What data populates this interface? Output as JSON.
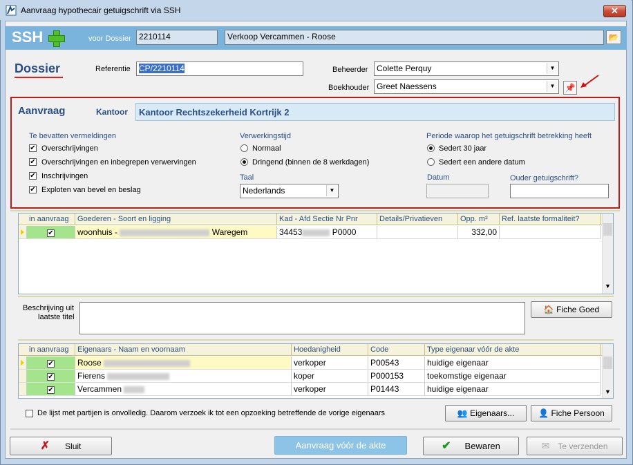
{
  "window": {
    "title": "Aanvraag hypothecair getuigschrift via SSH",
    "close": "✕"
  },
  "header": {
    "logo": "SSH",
    "voor_dossier_label": "voor Dossier",
    "dossier_nr": "2210114",
    "dossier_name": "Verkoop Vercammen - Roose"
  },
  "dossier": {
    "title": "Dossier",
    "referentie_label": "Referentie",
    "referentie_value": "CP/2210114",
    "beheerder_label": "Beheerder",
    "beheerder_value": "Colette Perquy",
    "boekhouder_label": "Boekhouder",
    "boekhouder_value": "Greet Naessens"
  },
  "aanvraag": {
    "title": "Aanvraag",
    "kantoor_label": "Kantoor",
    "kantoor_value": "Kantoor Rechtszekerheid Kortrijk 2",
    "vermeldingen_head": "Te bevatten vermeldingen",
    "vermeldingen": [
      {
        "label": "Overschrijvingen",
        "checked": "✔"
      },
      {
        "label": "Overschrijvingen en inbegrepen verwervingen",
        "checked": "✔"
      },
      {
        "label": "Inschrijvingen",
        "checked": "✔"
      },
      {
        "label": "Exploten van bevel en beslag",
        "checked": "✔"
      }
    ],
    "verwerking_head": "Verwerkingstijd",
    "verwerking_opts": [
      "Normaal",
      "Dringend (binnen de 8 werkdagen)"
    ],
    "taal_label": "Taal",
    "taal_value": "Nederlands",
    "periode_head": "Periode waarop het getuigschrift betrekking heeft",
    "periode_opts": [
      "Sedert 30 jaar",
      "Sedert een andere datum"
    ],
    "datum_label": "Datum",
    "ouder_label": "Ouder getuigschrift?"
  },
  "goederen": {
    "headers": [
      "in aanvraag",
      "Goederen - Soort en ligging",
      "Kad - Afd Sectie Nr Pnr",
      "Details/Privatieven",
      "Opp. m²",
      "Ref. laatste formaliteit?"
    ],
    "rows": [
      {
        "check": "✔",
        "soort": "woonhuis  -",
        "gemeente": "Waregem",
        "kad_prefix": "34453",
        "kad_suffix": "P0000",
        "details": "",
        "opp": "332,00",
        "ref": ""
      }
    ]
  },
  "beschrijving": {
    "label_line1": "Beschrijving uit",
    "label_line2": "laatste titel",
    "fiche_goed": "Fiche Goed"
  },
  "eigenaars": {
    "headers": [
      "in aanvraag",
      "Eigenaars - Naam en voornaam",
      "Hoedanigheid",
      "Code",
      "Type eigenaar vóór de akte"
    ],
    "rows": [
      {
        "check": "✔",
        "naam": "Roose",
        "hoedanigheid": "verkoper",
        "code": "P00543",
        "type": "huidige eigenaar"
      },
      {
        "check": "✔",
        "naam": "Fierens",
        "hoedanigheid": "koper",
        "code": "P000153",
        "type": "toekomstige eigenaar"
      },
      {
        "check": "✔",
        "naam": "Vercammen",
        "hoedanigheid": "verkoper",
        "code": "P01443",
        "type": "huidige eigenaar"
      }
    ]
  },
  "onvolledig_label": "De lijst met partijen is onvolledig. Daarom verzoek ik tot een opzoeking betreffende de vorige eigenaars",
  "buttons": {
    "eigenaars": "Eigenaars...",
    "fiche_persoon": "Fiche Persoon",
    "sluit": "Sluit",
    "aanvraag_voor_akte": "Aanvraag vóór de akte",
    "bewaren": "Bewaren",
    "te_verzenden": "Te verzenden"
  },
  "colors": {
    "accent": "#2a4e86",
    "band": "#7ab3dc",
    "highlight": "#c0181b",
    "green_cell": "#a4e48c"
  }
}
